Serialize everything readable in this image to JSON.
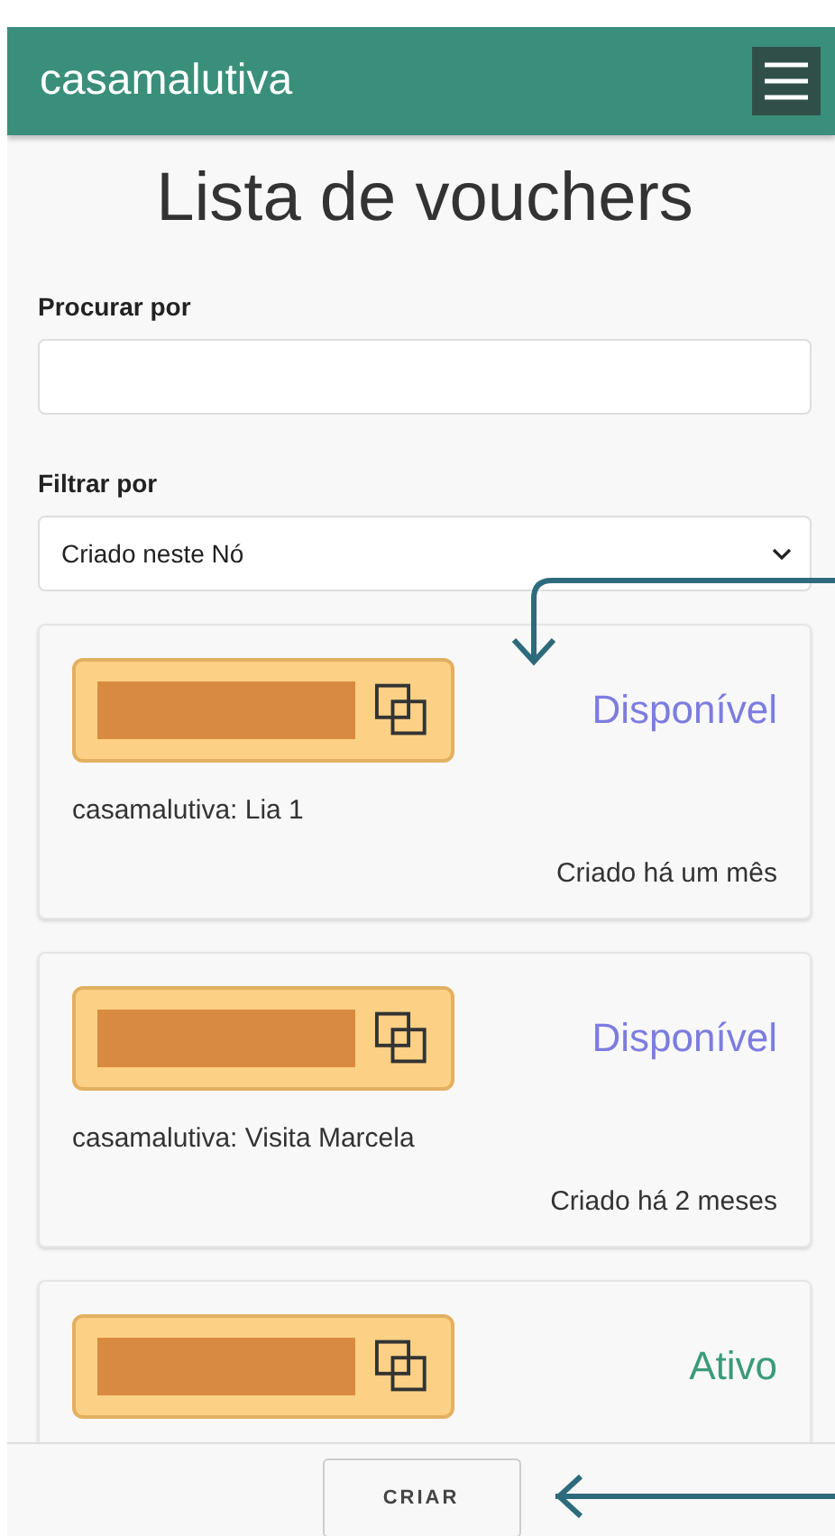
{
  "header": {
    "brand": "casamalutiva"
  },
  "title": "Lista de vouchers",
  "search": {
    "label": "Procurar por"
  },
  "filter": {
    "label": "Filtrar por",
    "value": "Criado neste Nó"
  },
  "vouchers": [
    {
      "status": "Disponível",
      "kind": "available",
      "name": "casamalutiva: Lia 1",
      "created": "Criado há um mês"
    },
    {
      "status": "Disponível",
      "kind": "available",
      "name": "casamalutiva: Visita Marcela",
      "created": "Criado há 2 meses"
    },
    {
      "status": "Ativo",
      "kind": "active"
    }
  ],
  "footer": {
    "button": "CRIAR"
  }
}
